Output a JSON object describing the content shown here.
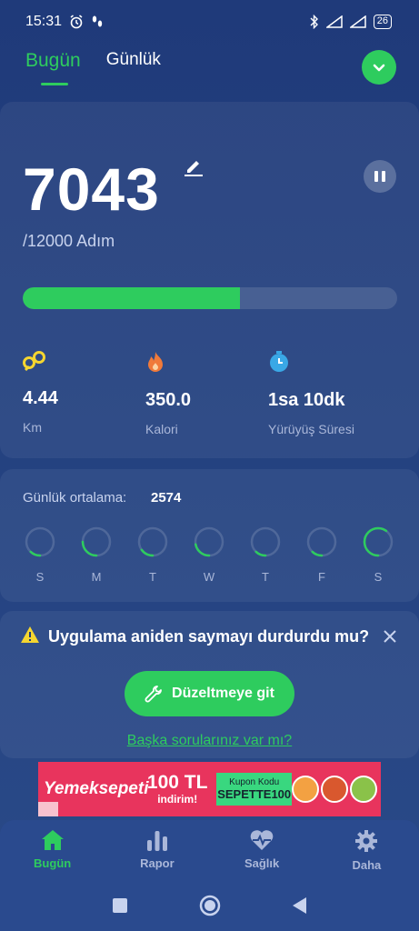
{
  "statusbar": {
    "time": "15:31",
    "battery": "26"
  },
  "tabs": [
    {
      "label": "Bugün"
    },
    {
      "label": "Günlük"
    }
  ],
  "steps": {
    "count": "7043",
    "goal": "/12000 Adım",
    "progress_fraction": 0.58
  },
  "metrics": [
    {
      "icon": "distance-icon",
      "value": "4.44",
      "label": "Km"
    },
    {
      "icon": "flame-icon",
      "value": "350.0",
      "label": "Kalori"
    },
    {
      "icon": "timer-icon",
      "value": "1sa 10dk",
      "label": "Yürüyüş Süresi"
    }
  ],
  "daily_average": {
    "label": "Günlük ortalama:",
    "value": "2574",
    "days": [
      {
        "label": "S",
        "fraction": 0.12
      },
      {
        "label": "M",
        "fraction": 0.25
      },
      {
        "label": "T",
        "fraction": 0.15
      },
      {
        "label": "W",
        "fraction": 0.22
      },
      {
        "label": "T",
        "fraction": 0.12
      },
      {
        "label": "F",
        "fraction": 0.12
      },
      {
        "label": "S",
        "fraction": 0.6
      }
    ]
  },
  "alert": {
    "text": "Uygulama aniden saymayı durdurdu mu?",
    "button": "Düzeltmeye git",
    "link": "Başka sorularınız var mı?"
  },
  "ad": {
    "brand": "Yemeksepeti",
    "amount": "100 TL",
    "amount_sub": "indirim!",
    "coupon_label": "Kupon Kodu",
    "coupon_code": "SEPETTE100"
  },
  "nav": [
    {
      "icon": "home-icon",
      "label": "Bugün"
    },
    {
      "icon": "bar-chart-icon",
      "label": "Rapor"
    },
    {
      "icon": "heart-pulse-icon",
      "label": "Sağlık"
    },
    {
      "icon": "gear-icon",
      "label": "Daha"
    }
  ],
  "colors": {
    "accent": "#2ecc5e",
    "background": "#23407f",
    "ad_background": "#e8345d"
  }
}
